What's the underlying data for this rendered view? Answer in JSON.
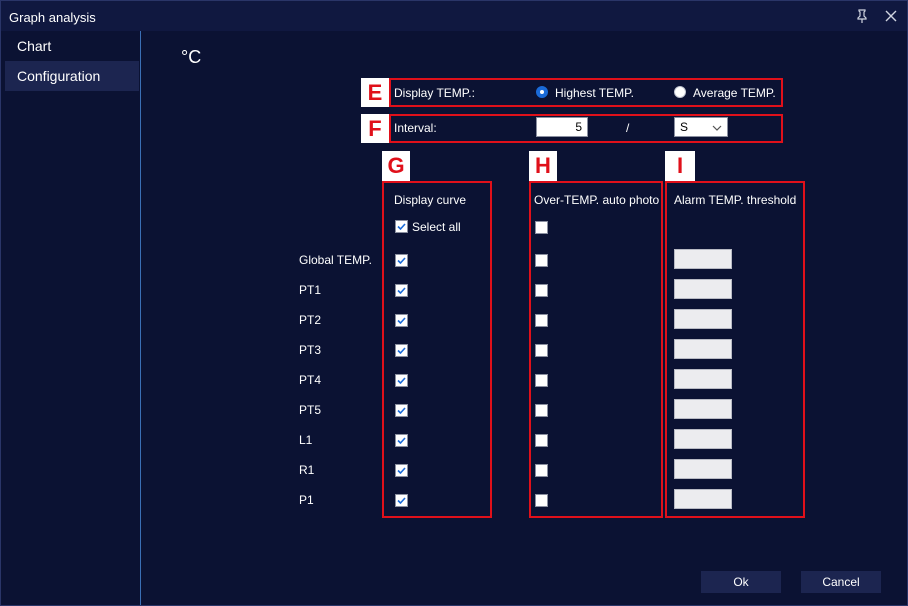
{
  "window": {
    "title": "Graph analysis"
  },
  "sidebar": {
    "items": [
      {
        "label": "Chart",
        "active": false
      },
      {
        "label": "Configuration",
        "active": true
      }
    ]
  },
  "unit": "°C",
  "display_temp": {
    "label": "Display TEMP.:",
    "options": [
      {
        "label": "Highest TEMP.",
        "selected": true
      },
      {
        "label": "Average TEMP.",
        "selected": false
      }
    ]
  },
  "interval": {
    "label": "Interval:",
    "value": "5",
    "separator": "/",
    "unit": "S"
  },
  "tags": {
    "E": "E",
    "F": "F",
    "G": "G",
    "H": "H",
    "I": "I"
  },
  "columns": {
    "display_curve": "Display curve",
    "auto_photo": "Over-TEMP. auto photo",
    "alarm": "Alarm TEMP. threshold"
  },
  "select_all": {
    "label": "Select all",
    "display_checked": true,
    "photo_checked": false
  },
  "rows": [
    {
      "label": "Global TEMP.",
      "display": true,
      "photo": false,
      "threshold": ""
    },
    {
      "label": "PT1",
      "display": true,
      "photo": false,
      "threshold": ""
    },
    {
      "label": "PT2",
      "display": true,
      "photo": false,
      "threshold": ""
    },
    {
      "label": "PT3",
      "display": true,
      "photo": false,
      "threshold": ""
    },
    {
      "label": "PT4",
      "display": true,
      "photo": false,
      "threshold": ""
    },
    {
      "label": "PT5",
      "display": true,
      "photo": false,
      "threshold": ""
    },
    {
      "label": "L1",
      "display": true,
      "photo": false,
      "threshold": ""
    },
    {
      "label": "R1",
      "display": true,
      "photo": false,
      "threshold": ""
    },
    {
      "label": "P1",
      "display": true,
      "photo": false,
      "threshold": ""
    }
  ],
  "buttons": {
    "ok": "Ok",
    "cancel": "Cancel"
  },
  "colors": {
    "background": "#0b1233",
    "highlight": "#e0101a",
    "accent": "#1a6ad8",
    "sidebar_border": "#3a6fb5"
  }
}
